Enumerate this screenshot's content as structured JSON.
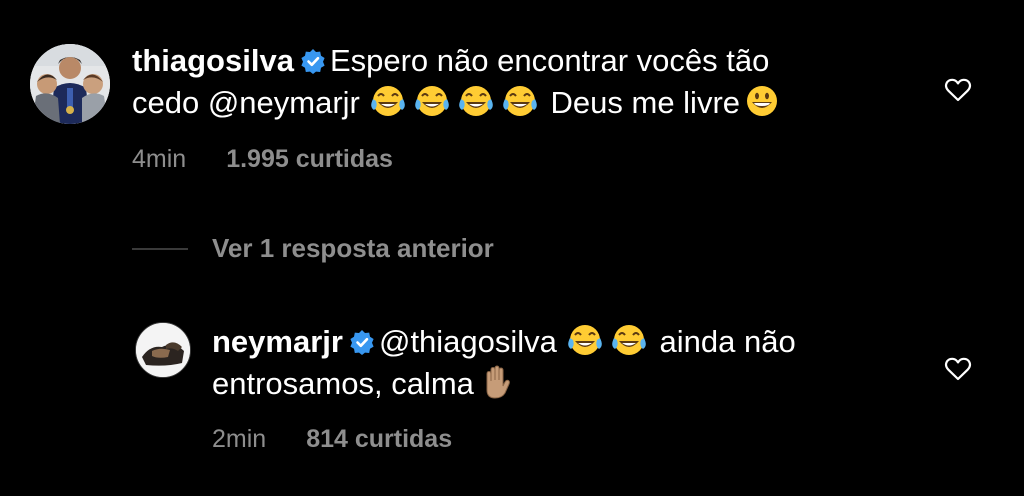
{
  "comments": [
    {
      "username": "thiagosilva",
      "verified": true,
      "text_part1": "Espero não encontrar vocês tão",
      "text_part2_prefix": "cedo @neymarjr",
      "laugh_emoji_count": 4,
      "text_part2_suffix": "Deus me livre",
      "trailing_emoji": "grinning-face",
      "time": "4min",
      "likes": "1.995 curtidas"
    },
    {
      "username": "neymarjr",
      "verified": true,
      "mention": "@thiagosilva",
      "laugh_emoji_count": 2,
      "text_part1_suffix": "ainda não",
      "text_part2": "entrosamos, calma",
      "trailing_emoji": "raised-hand",
      "time": "2min",
      "likes": "814 curtidas"
    }
  ],
  "replies_toggle": {
    "label": "Ver 1 resposta anterior"
  },
  "colors": {
    "background": "#000000",
    "text": "#ffffff",
    "muted": "#8e8e8e",
    "verified_badge": "#3897f0"
  },
  "icons": {
    "like": "heart-outline-icon",
    "verified": "verified-badge-icon",
    "laugh": "face-with-tears-of-joy-icon"
  }
}
